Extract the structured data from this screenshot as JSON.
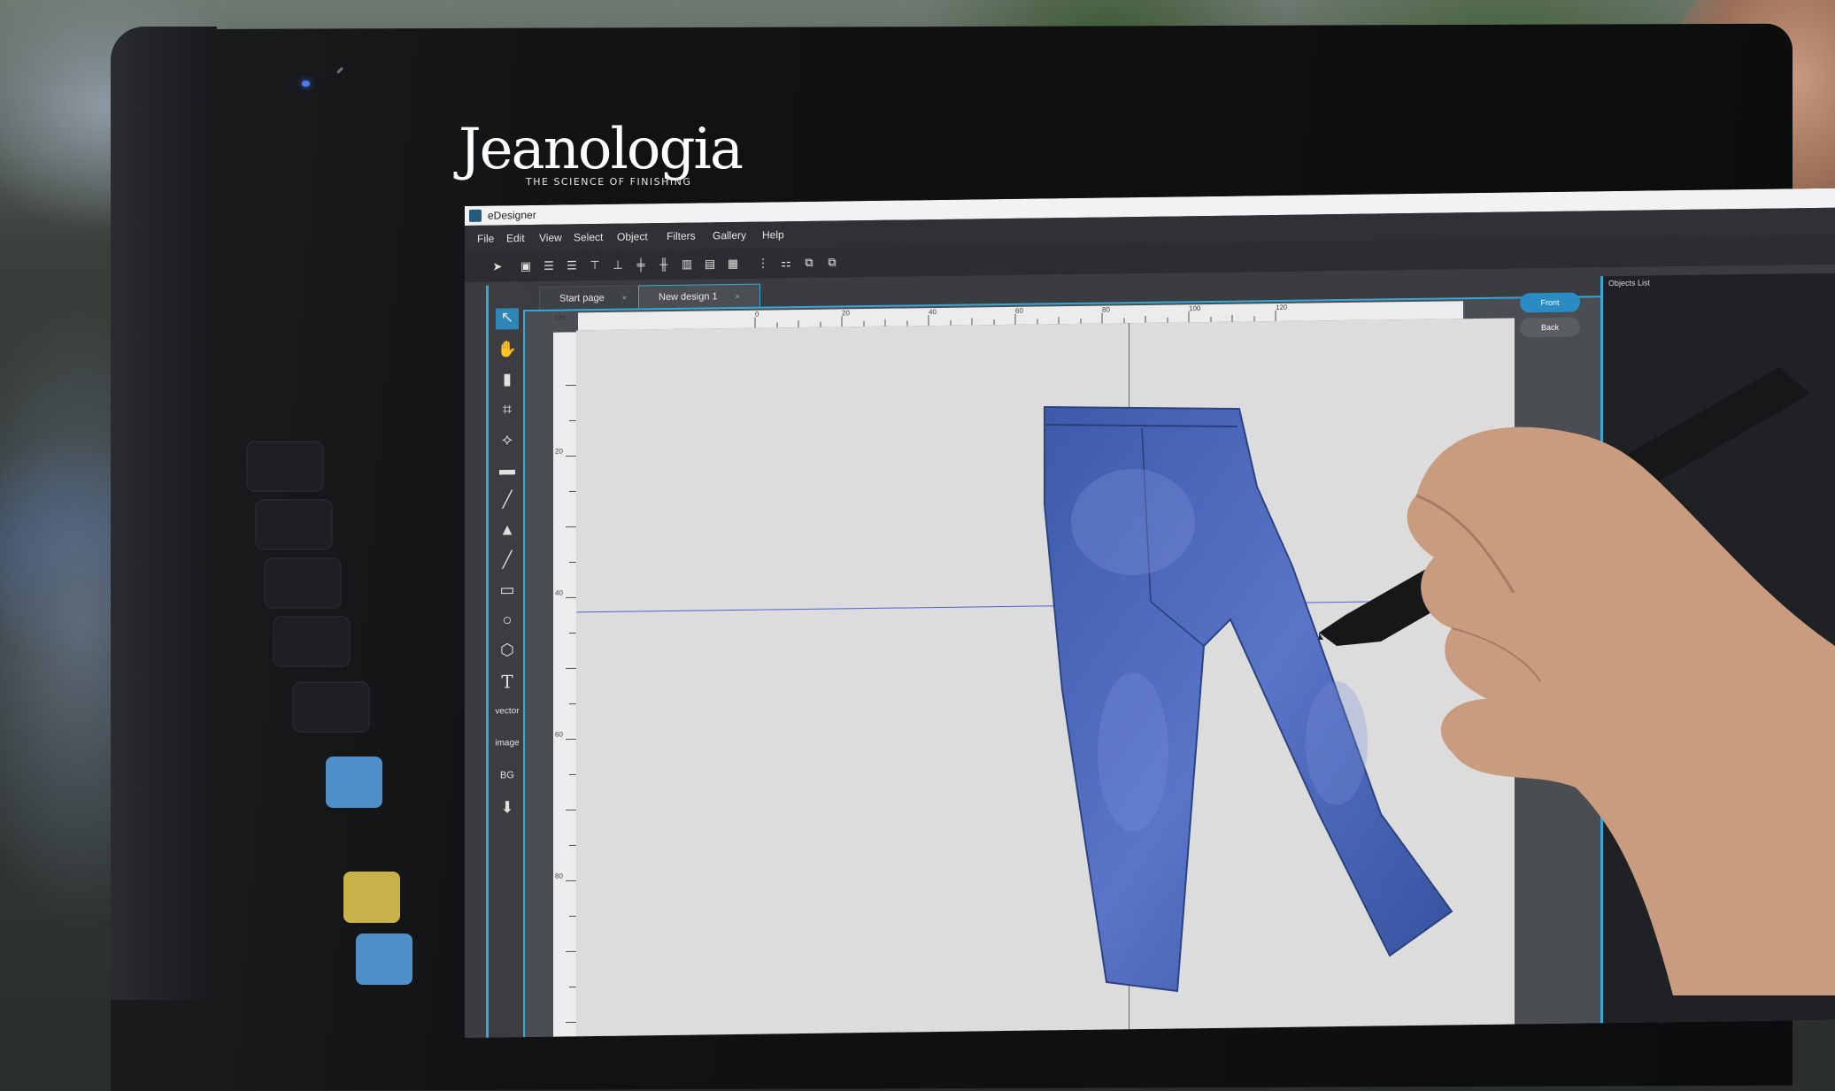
{
  "brand": {
    "name": "Jeanologia",
    "tagline": "THE SCIENCE OF FINISHING"
  },
  "window": {
    "title": "eDesigner"
  },
  "menu": [
    "File",
    "Edit",
    "View",
    "Select",
    "Object",
    "Filters",
    "Gallery",
    "Help"
  ],
  "tabs": [
    {
      "label": "Start page",
      "close": "×"
    },
    {
      "label": "New design 1",
      "close": "×"
    }
  ],
  "tools": {
    "select": "↖",
    "hand": "✋",
    "eraser": "▮",
    "crop": "⌗",
    "lasso": "⟡",
    "paint": "▬",
    "brush": "╱",
    "fill": "▲",
    "line": "╱",
    "rect": "▭",
    "circle": "○",
    "polygon": "⬡",
    "text": "T",
    "vector": "vector",
    "image": "image",
    "bg": "BG",
    "pin": "⬇"
  },
  "ruler": {
    "unit": "cm",
    "top_labels": [
      "0",
      "20",
      "40",
      "60",
      "80",
      "100",
      "120"
    ],
    "left_labels": [
      "20",
      "40",
      "60",
      "80"
    ]
  },
  "view_buttons": {
    "front": "Front",
    "back": "Back"
  },
  "objects_panel": {
    "title": "Objects List",
    "close": "×"
  },
  "colors": {
    "accent": "#35a7d8",
    "guide": "#4a63d6",
    "denim": "#4a62b8"
  }
}
